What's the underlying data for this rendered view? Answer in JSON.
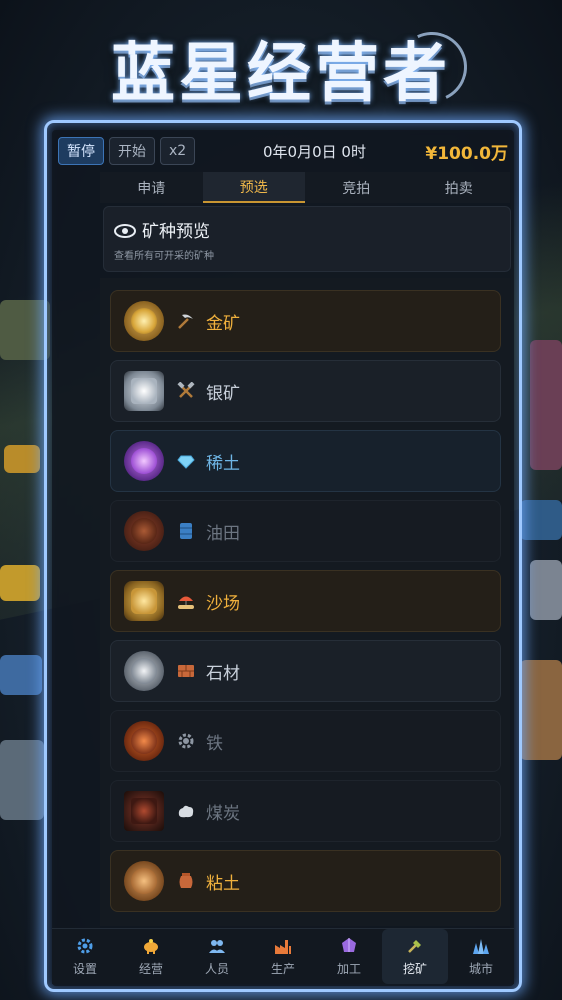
{
  "game_title": "蓝星经营者",
  "topbar": {
    "pause_label": "暂停",
    "start_label": "开始",
    "speed_label": "x2",
    "date": "0年0月0日 0时",
    "money": "¥100.0万"
  },
  "tabs": [
    "申请",
    "预选",
    "竞拍",
    "拍卖"
  ],
  "preview": {
    "title": "矿种预览",
    "subtitle": "查看所有可开采的矿种"
  },
  "minerals": [
    {
      "name": "金矿",
      "icon": "pickaxe-icon",
      "style": "gold"
    },
    {
      "name": "银矿",
      "icon": "hammer-pick-icon",
      "style": "white"
    },
    {
      "name": "稀土",
      "icon": "gem-icon",
      "style": "blue"
    },
    {
      "name": "油田",
      "icon": "oil-barrel-icon",
      "style": "dim"
    },
    {
      "name": "沙场",
      "icon": "sand-beach-icon",
      "style": "gold"
    },
    {
      "name": "石材",
      "icon": "brick-icon",
      "style": "white"
    },
    {
      "name": "铁",
      "icon": "gear-icon",
      "style": "dim"
    },
    {
      "name": "煤炭",
      "icon": "coal-rock-icon",
      "style": "dim"
    },
    {
      "name": "粘土",
      "icon": "clay-pot-icon",
      "style": "gold"
    }
  ],
  "nav": [
    {
      "label": "设置",
      "icon": "gear-icon"
    },
    {
      "label": "经营",
      "icon": "piggy-bank-icon"
    },
    {
      "label": "人员",
      "icon": "people-icon"
    },
    {
      "label": "生产",
      "icon": "factory-icon"
    },
    {
      "label": "加工",
      "icon": "crystal-icon"
    },
    {
      "label": "挖矿",
      "icon": "shovel-icon"
    },
    {
      "label": "城市",
      "icon": "city-icon"
    }
  ],
  "colors": {
    "accent_gold": "#f0b13d",
    "frame_glow": "#9fc9ff",
    "active_button": "#1e3c60"
  }
}
